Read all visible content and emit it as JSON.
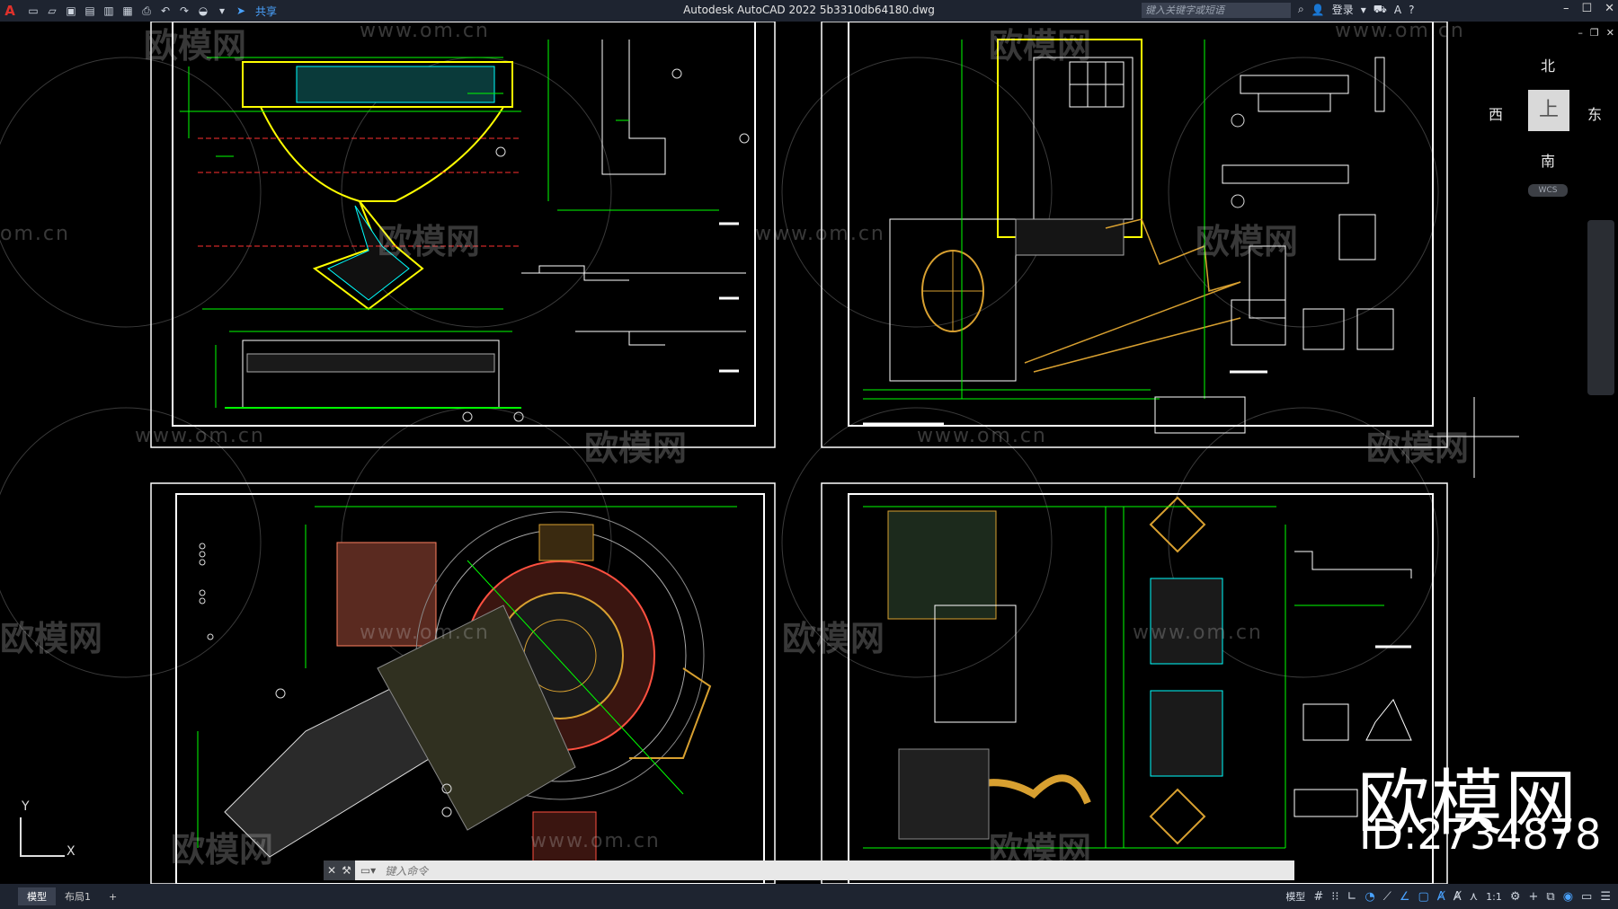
{
  "app": {
    "logo": "A",
    "title": "Autodesk AutoCAD 2022    5b3310db64180.dwg"
  },
  "quick_access": {
    "share_label": "共享"
  },
  "search": {
    "placeholder": "键入关键字或短语"
  },
  "account": {
    "login_label": "登录"
  },
  "viewcube": {
    "north": "北",
    "south": "南",
    "east": "东",
    "west": "西",
    "top_face": "上",
    "wcs": "WCS"
  },
  "command": {
    "prompt": "键入命令"
  },
  "tabs": [
    {
      "label": "模型"
    },
    {
      "label": "布局1"
    },
    {
      "label": "+"
    }
  ],
  "status": {
    "model_label": "模型",
    "scale": "1:1"
  },
  "ucs": {
    "y": "Y",
    "x": "X"
  },
  "watermarks": {
    "brand": "欧模网",
    "url": "www.om.cn",
    "url_short": "om.cn"
  },
  "brand_overlay": {
    "name": "欧模网",
    "id": "ID:2734878"
  },
  "colors": {
    "background": "#000000",
    "chrome": "#1e2430",
    "cad_green": "#00ff00",
    "cad_yellow": "#ffff00",
    "cad_cyan": "#00ffff",
    "cad_red": "#ff3030",
    "sheet_border": "#ffffff"
  }
}
